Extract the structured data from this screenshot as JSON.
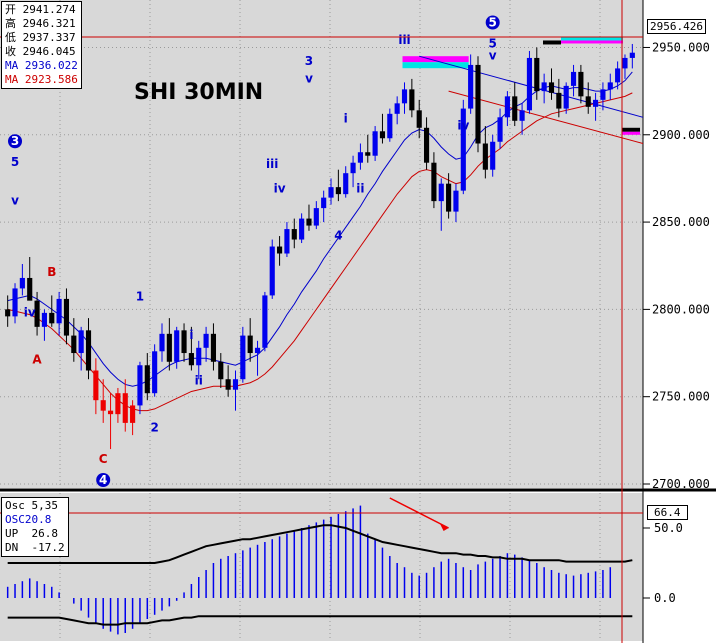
{
  "title": "SHI 30MIN",
  "last_price": "2956.426",
  "ohlc": [
    {
      "label": "开",
      "value": "2941.274"
    },
    {
      "label": "高",
      "value": "2946.321"
    },
    {
      "label": "低",
      "value": "2937.337"
    },
    {
      "label": "收",
      "value": "2946.045"
    }
  ],
  "ma": [
    {
      "label": "MA",
      "value": "2936.022",
      "color": "#0000cc"
    },
    {
      "label": "MA",
      "value": "2923.586",
      "color": "#cc0000"
    }
  ],
  "osc": {
    "name": "Osc 5,35",
    "series_label": "OSC20.8",
    "up_label": "UP",
    "up_value": "26.8",
    "dn_label": "DN",
    "dn_value": "-17.2",
    "last": "66.4"
  },
  "colors": {
    "background": "#d8d8d8",
    "bull": "#0000ee",
    "bear": "#000000",
    "wave_c": "#ee0000",
    "ma_fast": "#0000cc",
    "ma_slow": "#cc0000",
    "cursor": "#cc0000",
    "highlight_magenta": "#ff00ff",
    "highlight_cyan": "#00e5e5"
  },
  "chart_data": [
    {
      "type": "candlestick",
      "title": "SHI 30MIN",
      "ylim": [
        2700,
        2960
      ],
      "y_ticks": [
        "2950.000",
        "2900.000",
        "2850.000",
        "2800.000",
        "2750.000",
        "2700.000"
      ],
      "y_tick_values": [
        2950,
        2900,
        2850,
        2800,
        2750,
        2700
      ],
      "grid": true,
      "candles": [
        [
          2800,
          2808,
          2790,
          2796
        ],
        [
          2796,
          2815,
          2792,
          2812
        ],
        [
          2812,
          2826,
          2808,
          2818
        ],
        [
          2818,
          2830,
          2812,
          2805
        ],
        [
          2805,
          2810,
          2785,
          2790
        ],
        [
          2790,
          2800,
          2782,
          2798
        ],
        [
          2798,
          2808,
          2790,
          2792
        ],
        [
          2792,
          2810,
          2785,
          2806
        ],
        [
          2806,
          2812,
          2780,
          2785
        ],
        [
          2785,
          2795,
          2770,
          2775
        ],
        [
          2775,
          2790,
          2765,
          2788
        ],
        [
          2788,
          2795,
          2760,
          2765
        ],
        [
          2765,
          2772,
          2740,
          2748
        ],
        [
          2748,
          2760,
          2735,
          2742
        ],
        [
          2742,
          2752,
          2720,
          2740
        ],
        [
          2740,
          2755,
          2735,
          2752
        ],
        [
          2752,
          2760,
          2730,
          2735
        ],
        [
          2735,
          2748,
          2728,
          2745
        ],
        [
          2745,
          2770,
          2740,
          2768
        ],
        [
          2768,
          2775,
          2748,
          2752
        ],
        [
          2752,
          2780,
          2750,
          2776
        ],
        [
          2776,
          2792,
          2770,
          2786
        ],
        [
          2786,
          2795,
          2765,
          2770
        ],
        [
          2770,
          2790,
          2766,
          2788
        ],
        [
          2788,
          2792,
          2770,
          2775
        ],
        [
          2775,
          2790,
          2765,
          2768
        ],
        [
          2768,
          2782,
          2760,
          2778
        ],
        [
          2778,
          2790,
          2770,
          2786
        ],
        [
          2786,
          2792,
          2765,
          2770
        ],
        [
          2770,
          2775,
          2755,
          2760
        ],
        [
          2760,
          2768,
          2750,
          2754
        ],
        [
          2754,
          2765,
          2742,
          2760
        ],
        [
          2760,
          2790,
          2758,
          2785
        ],
        [
          2785,
          2795,
          2770,
          2775
        ],
        [
          2775,
          2782,
          2762,
          2778
        ],
        [
          2778,
          2810,
          2776,
          2808
        ],
        [
          2808,
          2840,
          2806,
          2836
        ],
        [
          2836,
          2842,
          2825,
          2832
        ],
        [
          2832,
          2850,
          2830,
          2846
        ],
        [
          2846,
          2852,
          2835,
          2840
        ],
        [
          2840,
          2855,
          2838,
          2852
        ],
        [
          2852,
          2860,
          2845,
          2848
        ],
        [
          2848,
          2862,
          2846,
          2858
        ],
        [
          2858,
          2868,
          2850,
          2864
        ],
        [
          2864,
          2875,
          2860,
          2870
        ],
        [
          2870,
          2880,
          2862,
          2866
        ],
        [
          2866,
          2882,
          2864,
          2878
        ],
        [
          2878,
          2888,
          2870,
          2884
        ],
        [
          2884,
          2895,
          2880,
          2890
        ],
        [
          2890,
          2900,
          2884,
          2888
        ],
        [
          2888,
          2905,
          2885,
          2902
        ],
        [
          2902,
          2912,
          2895,
          2898
        ],
        [
          2898,
          2915,
          2896,
          2912
        ],
        [
          2912,
          2922,
          2906,
          2918
        ],
        [
          2918,
          2930,
          2912,
          2926
        ],
        [
          2926,
          2932,
          2910,
          2914
        ],
        [
          2914,
          2920,
          2898,
          2904
        ],
        [
          2904,
          2910,
          2880,
          2884
        ],
        [
          2884,
          2890,
          2858,
          2862
        ],
        [
          2862,
          2875,
          2845,
          2872
        ],
        [
          2872,
          2878,
          2852,
          2856
        ],
        [
          2856,
          2872,
          2850,
          2868
        ],
        [
          2868,
          2920,
          2866,
          2915
        ],
        [
          2915,
          2946,
          2912,
          2940
        ],
        [
          2940,
          2945,
          2890,
          2895
        ],
        [
          2895,
          2905,
          2875,
          2880
        ],
        [
          2880,
          2900,
          2876,
          2896
        ],
        [
          2896,
          2915,
          2892,
          2910
        ],
        [
          2910,
          2925,
          2905,
          2922
        ],
        [
          2922,
          2930,
          2905,
          2908
        ],
        [
          2908,
          2918,
          2900,
          2914
        ],
        [
          2914,
          2948,
          2912,
          2944
        ],
        [
          2944,
          2950,
          2920,
          2925
        ],
        [
          2925,
          2935,
          2918,
          2930
        ],
        [
          2930,
          2938,
          2920,
          2924
        ],
        [
          2924,
          2932,
          2910,
          2915
        ],
        [
          2915,
          2930,
          2912,
          2928
        ],
        [
          2928,
          2940,
          2922,
          2936
        ],
        [
          2936,
          2940,
          2918,
          2922
        ],
        [
          2922,
          2930,
          2912,
          2916
        ],
        [
          2916,
          2924,
          2908,
          2920
        ],
        [
          2920,
          2930,
          2914,
          2926
        ],
        [
          2926,
          2935,
          2920,
          2930
        ],
        [
          2930,
          2942,
          2926,
          2938
        ],
        [
          2938,
          2946,
          2932,
          2944
        ],
        [
          2944,
          2952,
          2938,
          2947
        ]
      ],
      "ma_fast": [
        2805,
        2806,
        2807,
        2808,
        2806,
        2803,
        2800,
        2797,
        2794,
        2790,
        2786,
        2781,
        2775,
        2769,
        2764,
        2760,
        2757,
        2756,
        2757,
        2759,
        2762,
        2765,
        2768,
        2770,
        2771,
        2772,
        2772,
        2772,
        2771,
        2770,
        2769,
        2768,
        2770,
        2772,
        2774,
        2778,
        2784,
        2790,
        2797,
        2803,
        2810,
        2816,
        2822,
        2829,
        2835,
        2841,
        2847,
        2853,
        2859,
        2866,
        2872,
        2879,
        2885,
        2891,
        2897,
        2901,
        2903,
        2902,
        2898,
        2893,
        2889,
        2886,
        2887,
        2893,
        2900,
        2904,
        2906,
        2909,
        2913,
        2916,
        2918,
        2922,
        2925,
        2927,
        2928,
        2927,
        2926,
        2927,
        2927,
        2926,
        2925,
        2925,
        2926,
        2928,
        2931,
        2936
      ],
      "ma_slow": [
        2800,
        2799,
        2798,
        2797,
        2795,
        2792,
        2789,
        2785,
        2781,
        2777,
        2772,
        2767,
        2762,
        2757,
        2752,
        2748,
        2745,
        2743,
        2742,
        2742,
        2743,
        2745,
        2747,
        2749,
        2751,
        2753,
        2754,
        2755,
        2756,
        2756,
        2756,
        2756,
        2757,
        2758,
        2760,
        2763,
        2767,
        2772,
        2777,
        2782,
        2788,
        2794,
        2800,
        2806,
        2812,
        2818,
        2824,
        2830,
        2836,
        2842,
        2848,
        2854,
        2860,
        2866,
        2871,
        2876,
        2879,
        2880,
        2879,
        2876,
        2874,
        2872,
        2873,
        2877,
        2882,
        2886,
        2889,
        2892,
        2896,
        2899,
        2902,
        2905,
        2908,
        2910,
        2912,
        2913,
        2914,
        2915,
        2916,
        2917,
        2918,
        2919,
        2920,
        2921,
        2922,
        2924
      ],
      "wave_labels": [
        {
          "text": "3",
          "i": 1,
          "price": 2894,
          "color": "#0000cc",
          "circled": true
        },
        {
          "text": "5",
          "i": 1,
          "price": 2882,
          "color": "#0000cc"
        },
        {
          "text": "v",
          "i": 1,
          "price": 2860,
          "color": "#0000cc"
        },
        {
          "text": "iv",
          "i": 3,
          "price": 2796,
          "color": "#0000cc"
        },
        {
          "text": "B",
          "i": 6,
          "price": 2819,
          "color": "#cc0000"
        },
        {
          "text": "A",
          "i": 4,
          "price": 2769,
          "color": "#cc0000"
        },
        {
          "text": "C",
          "i": 13,
          "price": 2712,
          "color": "#cc0000"
        },
        {
          "text": "4",
          "i": 13,
          "price": 2700,
          "color": "#0000cc",
          "circled": true
        },
        {
          "text": "1",
          "i": 18,
          "price": 2805,
          "color": "#0000cc"
        },
        {
          "text": "i",
          "i": 25,
          "price": 2783,
          "color": "#0000cc"
        },
        {
          "text": "ii",
          "i": 26,
          "price": 2757,
          "color": "#0000cc"
        },
        {
          "text": "2",
          "i": 20,
          "price": 2730,
          "color": "#0000cc"
        },
        {
          "text": "iii",
          "i": 36,
          "price": 2881,
          "color": "#0000cc"
        },
        {
          "text": "iv",
          "i": 37,
          "price": 2867,
          "color": "#0000cc"
        },
        {
          "text": "3",
          "i": 41,
          "price": 2940,
          "color": "#0000cc"
        },
        {
          "text": "v",
          "i": 41,
          "price": 2930,
          "color": "#0000cc"
        },
        {
          "text": "4",
          "i": 45,
          "price": 2840,
          "color": "#0000cc"
        },
        {
          "text": "i",
          "i": 46,
          "price": 2907,
          "color": "#0000cc"
        },
        {
          "text": "ii",
          "i": 48,
          "price": 2867,
          "color": "#0000cc"
        },
        {
          "text": "iii",
          "i": 54,
          "price": 2952,
          "color": "#0000cc"
        },
        {
          "text": "iv",
          "i": 62,
          "price": 2903,
          "color": "#0000cc"
        },
        {
          "text": "5",
          "i": 66,
          "price": 2962,
          "color": "#0000cc",
          "circled": true
        },
        {
          "text": "5",
          "i": 66,
          "price": 2950,
          "color": "#0000cc"
        },
        {
          "text": "v",
          "i": 66,
          "price": 2943,
          "color": "#0000cc"
        }
      ]
    },
    {
      "type": "bar",
      "title": "Osc 5,35",
      "ylim": [
        -30,
        70
      ],
      "y_ticks": [
        "50.0",
        "0.0"
      ],
      "y_tick_values": [
        50,
        0
      ],
      "values": [
        8,
        10,
        12,
        14,
        12,
        10,
        8,
        4,
        0,
        -4,
        -9,
        -14,
        -18,
        -22,
        -24,
        -26,
        -25,
        -22,
        -18,
        -15,
        -12,
        -9,
        -6,
        -2,
        4,
        10,
        15,
        20,
        25,
        28,
        30,
        32,
        34,
        36,
        38,
        40,
        42,
        44,
        46,
        48,
        50,
        52,
        54,
        56,
        58,
        60,
        62,
        64,
        66,
        46,
        42,
        36,
        30,
        25,
        22,
        18,
        16,
        18,
        22,
        26,
        28,
        25,
        22,
        20,
        24,
        26,
        28,
        30,
        32,
        31,
        29,
        27,
        25,
        22,
        20,
        18,
        17,
        16,
        17,
        18,
        19,
        20,
        22
      ],
      "up": [
        25,
        25,
        25,
        25,
        25,
        25,
        25,
        25,
        25,
        25,
        25,
        25,
        25,
        25,
        25,
        25,
        25,
        25,
        25,
        25,
        25,
        26,
        27,
        29,
        31,
        33,
        35,
        37,
        38,
        39,
        40,
        41,
        42,
        42,
        43,
        44,
        45,
        46,
        47,
        48,
        49,
        50,
        51,
        52,
        52,
        51,
        50,
        48,
        46,
        44,
        42,
        40,
        39,
        38,
        37,
        36,
        35,
        34,
        33,
        32,
        32,
        32,
        31,
        31,
        30,
        30,
        29,
        29,
        28,
        28,
        28,
        27,
        27,
        27,
        27,
        27,
        26,
        26,
        26,
        26,
        26,
        26,
        26,
        26,
        26,
        27
      ],
      "dn": [
        -14,
        -14,
        -14,
        -14,
        -14,
        -14,
        -14,
        -14,
        -15,
        -16,
        -17,
        -18,
        -18,
        -19,
        -19,
        -19,
        -18,
        -18,
        -18,
        -18,
        -17,
        -16,
        -16,
        -15,
        -14,
        -14,
        -13,
        -13,
        -13,
        -13,
        -13,
        -13,
        -13,
        -13,
        -13,
        -13,
        -13,
        -13,
        -13,
        -13,
        -13,
        -13,
        -13,
        -13,
        -13,
        -13,
        -13,
        -13,
        -13,
        -13,
        -13,
        -13,
        -13,
        -13,
        -13,
        -13,
        -13,
        -13,
        -13,
        -13,
        -13,
        -13,
        -13,
        -13,
        -13,
        -13,
        -13,
        -13,
        -13,
        -13,
        -13,
        -13,
        -13,
        -13,
        -13,
        -13,
        -13,
        -13,
        -13,
        -13,
        -13,
        -13,
        -13,
        -13,
        -13,
        -13
      ]
    }
  ]
}
